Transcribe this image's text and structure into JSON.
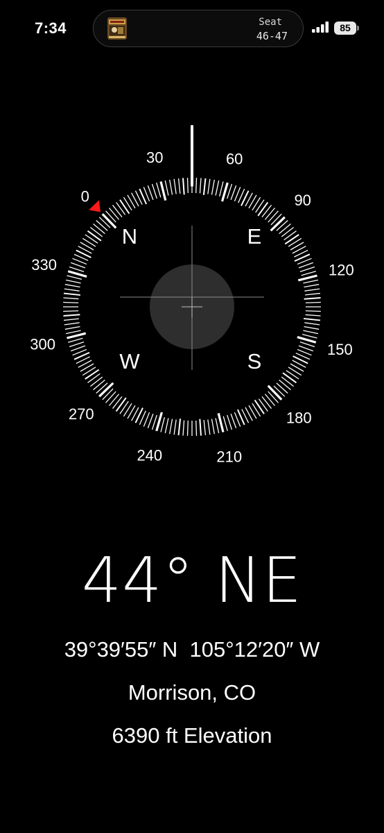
{
  "status_bar": {
    "time": "7:34",
    "battery_level": "85",
    "signal_icon": "cellular-signal-icon",
    "battery_icon": "battery-icon"
  },
  "live_activity": {
    "seat_label": "Seat",
    "seat_value": "46-47",
    "thumbnail_icon": "event-thumbnail-icon"
  },
  "compass": {
    "heading_degrees": 44,
    "bearing_marker_degrees": 0,
    "degree_labels": [
      "0",
      "30",
      "60",
      "90",
      "120",
      "150",
      "180",
      "210",
      "240",
      "270",
      "300",
      "330"
    ],
    "cardinals": {
      "north": "N",
      "east": "E",
      "south": "S",
      "west": "W"
    },
    "colors": {
      "background": "#000000",
      "ticks": "#ffffff",
      "bearing_marker": "#ff1a1a",
      "level_bubble": "#2e2e2e",
      "crosshair": "#8a8a8a"
    }
  },
  "readout": {
    "heading": "44° NE",
    "coordinates": "39°39′55″ N  105°12′20″ W",
    "location": "Morrison, CO",
    "elevation": "6390 ft Elevation"
  }
}
